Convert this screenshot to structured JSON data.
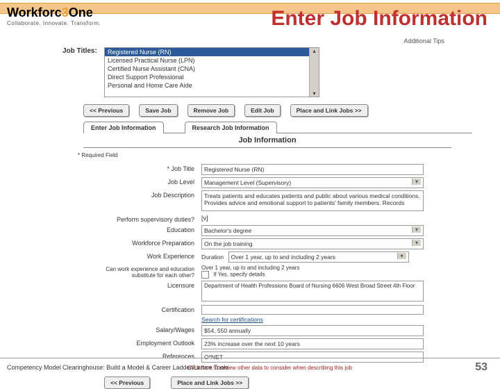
{
  "header": {
    "logo_main": "Workforc",
    "logo_accent": "3",
    "logo_suffix": "One",
    "tagline": "Collaborate.  Innovate.  Transform.",
    "slide_title": "Enter Job Information"
  },
  "top": {
    "additional_tips": "Additional Tips",
    "job_titles_label": "Job Titles:",
    "options": [
      "Registered Nurse (RN)",
      "Licensed Practical Nurse (LPN)",
      "Certified Nurse Assistant (CNA)",
      "Direct Support Professional",
      "Personal and Home Care Aide"
    ]
  },
  "buttons": {
    "prev": "<< Previous",
    "save": "Save Job",
    "remove": "Remove Job",
    "edit": "Edit Job",
    "place": "Place and Link Jobs >>"
  },
  "tabs": {
    "enter": "Enter Job Information",
    "research": "Research Job Information"
  },
  "section": {
    "title": "Job Information",
    "required_note": "* Required Field"
  },
  "form": {
    "job_title": {
      "label": "* Job Title",
      "value": "Registered Nurse (RN)"
    },
    "job_level": {
      "label": "Job Level",
      "value": "Management Level (Supervisory)"
    },
    "job_desc": {
      "label": "Job Description",
      "value": "Treats patients and educates patients and public about various medical conditions. Provides advice and emotional support to patients' family members. Records"
    },
    "supervisory": {
      "label": "Perform supervisory duties?",
      "value": "[v]"
    },
    "education": {
      "label": "Education",
      "value": "Bachelor's degree"
    },
    "workforce_prep": {
      "label": "Workforce Preparation",
      "value": "On the job training"
    },
    "work_exp": {
      "label": "Work Experience",
      "duration_label": "Duration",
      "duration_value": "Over 1 year, up to and including 2 years",
      "line2": "Over 1 year, up to and including 2 years"
    },
    "substitute": {
      "label": "Can work experience and education substitute for each other?",
      "detail": "If Yes, specify details"
    },
    "licensure": {
      "label": "Licensure",
      "value": "Department of Health Professions Board of Nursing\n6606 West Broad Street\n4th Floor"
    },
    "certification": {
      "label": "Certification",
      "search": "Search for certifications"
    },
    "salary": {
      "label": "Salary/Wages",
      "value": "$54, 550 annually"
    },
    "outlook": {
      "label": "Employment Outlook",
      "value": "23% increase over the next 10 years"
    },
    "references": {
      "label": "References",
      "value": "O*NET"
    }
  },
  "click_note": "Click here to review other data to consider when describing this job",
  "footer": {
    "text": "Competency Model Clearinghouse: Build a Model & Career Ladder/Lattice Tools",
    "page": "53"
  }
}
